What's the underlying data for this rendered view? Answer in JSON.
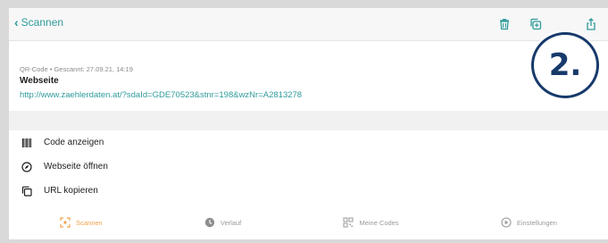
{
  "topbar": {
    "back_label": "Scannen",
    "icons": [
      "trash-icon",
      "copy-add-icon",
      "share-icon"
    ],
    "accent": "#2f9a9a"
  },
  "badge": {
    "label": "2."
  },
  "result": {
    "meta": "QR-Code • Gescannt: 27.09.21, 14:19",
    "title": "Webseite",
    "url": "http://www.zaehlerdaten.at/?sdaId=GDE70523&stnr=198&wzNr=A2813278"
  },
  "actions": [
    {
      "label": "Code anzeigen",
      "icon": "barcode-icon"
    },
    {
      "label": "Webseite öffnen",
      "icon": "compass-icon"
    },
    {
      "label": "URL kopieren",
      "icon": "copy-icon"
    }
  ],
  "tabbar": {
    "tabs": [
      {
        "label": "Scannen",
        "icon": "scan-icon",
        "active": true
      },
      {
        "label": "Verlauf",
        "icon": "clock-icon",
        "active": false
      },
      {
        "label": "Meine Codes",
        "icon": "qr-grid-icon",
        "active": false
      },
      {
        "label": "Einstellungen",
        "icon": "settings-icon",
        "active": false
      }
    ],
    "active_color": "#f2a24a"
  }
}
